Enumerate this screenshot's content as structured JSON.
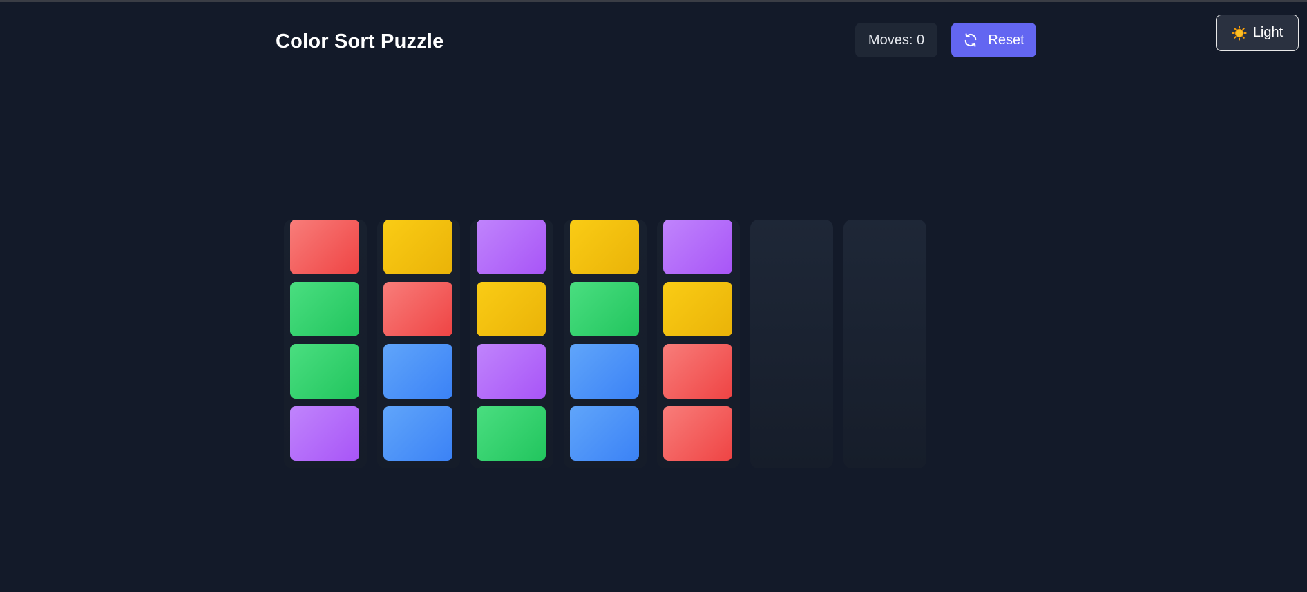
{
  "header": {
    "title": "Color Sort Puzzle",
    "moves_label": "Moves: 0",
    "reset_label": "Reset",
    "theme_label": "Light"
  },
  "icons": {
    "reset": "refresh-icon",
    "theme": "sun-icon"
  },
  "colors": {
    "background": "#131a29",
    "accent": "#6366f1",
    "red": "#ef4444",
    "green": "#22c55e",
    "yellow": "#eab308",
    "purple": "#a855f7",
    "blue": "#3b82f6"
  },
  "board": {
    "tubes": [
      [
        "red",
        "green",
        "green",
        "purple"
      ],
      [
        "yellow",
        "red",
        "blue",
        "blue"
      ],
      [
        "purple",
        "yellow",
        "purple",
        "green"
      ],
      [
        "yellow",
        "green",
        "blue",
        "blue"
      ],
      [
        "purple",
        "yellow",
        "red",
        "red"
      ],
      [],
      []
    ]
  }
}
